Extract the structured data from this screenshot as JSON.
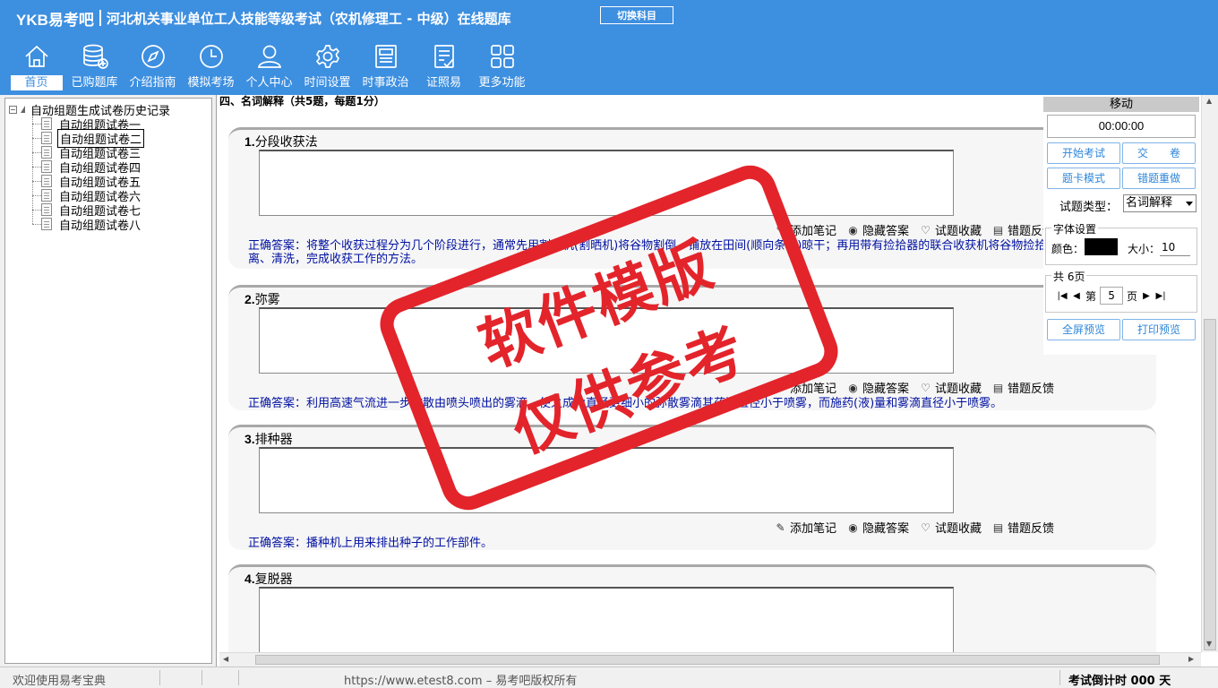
{
  "header": {
    "brand": "YKB易考吧",
    "title": "河北机关事业单位工人技能等级考试（农机修理工 - 中级）在线题库",
    "switch_label": "切换科目"
  },
  "toolbar": {
    "items": [
      {
        "label": "首页",
        "icon": "home-icon"
      },
      {
        "label": "已购题库",
        "icon": "database-icon"
      },
      {
        "label": "介绍指南",
        "icon": "compass-icon"
      },
      {
        "label": "模拟考场",
        "icon": "clock-icon"
      },
      {
        "label": "个人中心",
        "icon": "user-icon"
      },
      {
        "label": "时间设置",
        "icon": "gear-icon"
      },
      {
        "label": "时事政治",
        "icon": "newspaper-icon"
      },
      {
        "label": "证照易",
        "icon": "checklist-icon"
      },
      {
        "label": "更多功能",
        "icon": "grid-icon"
      }
    ]
  },
  "tree": {
    "root": "自动组题生成试卷历史记录",
    "items": [
      "自动组题试卷一",
      "自动组题试卷二",
      "自动组题试卷三",
      "自动组题试卷四",
      "自动组题试卷五",
      "自动组题试卷六",
      "自动组题试卷七",
      "自动组题试卷八"
    ]
  },
  "content": {
    "section_header": "四、名词解释（共5题，每题1分）",
    "actions": {
      "add_note": "添加笔记",
      "hide_answer": "隐藏答案",
      "favorite": "试题收藏",
      "feedback": "错题反馈"
    },
    "questions": [
      {
        "number": "1.",
        "title": "分段收获法",
        "answer": "正确答案：将整个收获过程分为几个阶段进行，通常先用割晒机(割晒机)将谷物割倒，铺放在田间(顺向条铺)晾干；再用带有捡拾器的联合收获机将谷物捡拾起，并进行脱粒、分离、清洗，完成收获工作的方法。"
      },
      {
        "number": "2.",
        "title": "弥雾",
        "answer": "正确答案：利用高速气流进一步吹散由喷头喷出的雾滴，使之成为直径更细小的弥散雾滴其药滴直径小于喷雾，而施药(液)量和雾滴直径小于喷雾。"
      },
      {
        "number": "3.",
        "title": "排种器",
        "answer": "正确答案：播种机上用来排出种子的工作部件。"
      },
      {
        "number": "4.",
        "title": "复脱器",
        "answer": ""
      }
    ]
  },
  "right_panel": {
    "move_label": "移动",
    "timer": "00:00:00",
    "start_exam": "开始考试",
    "submit": "交　　卷",
    "card_mode": "题卡模式",
    "redo_wrong": "错题重做",
    "qtype_label": "试题类型：",
    "qtype_value": "名词解释",
    "font_legend": "字体设置",
    "color_label": "颜色：",
    "color_value": "#000000",
    "size_label": "大小：",
    "size_value": "10",
    "pages_legend": "共 6页",
    "page_prefix": "第",
    "page_value": "5",
    "page_suffix": "页",
    "fullscreen": "全屏预览",
    "print_preview": "打印预览"
  },
  "status": {
    "welcome": "欢迎使用易考宝典",
    "copyright": "https://www.etest8.com – 易考吧版权所有",
    "countdown": "考试倒计时 000 天"
  },
  "watermark": {
    "line1": "软件模版",
    "line2": "仅供参考"
  },
  "colors": {
    "header_bg": "#3d8fe0",
    "answer_text": "#0010a0",
    "stamp": "#e3242b",
    "button_text": "#2e86d8"
  }
}
